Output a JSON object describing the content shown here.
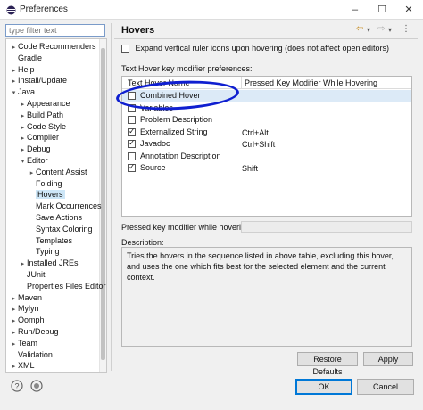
{
  "window": {
    "title": "Preferences",
    "minimize": "–",
    "maximize": "☐",
    "close": "✕"
  },
  "filter": {
    "placeholder": "type filter text"
  },
  "tree": [
    {
      "label": "Code Recommenders",
      "level": 0,
      "arrow": "▸"
    },
    {
      "label": "Gradle",
      "level": 0,
      "arrow": ""
    },
    {
      "label": "Help",
      "level": 0,
      "arrow": "▸"
    },
    {
      "label": "Install/Update",
      "level": 0,
      "arrow": "▸"
    },
    {
      "label": "Java",
      "level": 0,
      "arrow": "▾"
    },
    {
      "label": "Appearance",
      "level": 1,
      "arrow": "▸"
    },
    {
      "label": "Build Path",
      "level": 1,
      "arrow": "▸"
    },
    {
      "label": "Code Style",
      "level": 1,
      "arrow": "▸"
    },
    {
      "label": "Compiler",
      "level": 1,
      "arrow": "▸"
    },
    {
      "label": "Debug",
      "level": 1,
      "arrow": "▸"
    },
    {
      "label": "Editor",
      "level": 1,
      "arrow": "▾"
    },
    {
      "label": "Content Assist",
      "level": 2,
      "arrow": "▸"
    },
    {
      "label": "Folding",
      "level": 2,
      "arrow": ""
    },
    {
      "label": "Hovers",
      "level": 2,
      "arrow": "",
      "selected": true
    },
    {
      "label": "Mark Occurrences",
      "level": 2,
      "arrow": ""
    },
    {
      "label": "Save Actions",
      "level": 2,
      "arrow": ""
    },
    {
      "label": "Syntax Coloring",
      "level": 2,
      "arrow": ""
    },
    {
      "label": "Templates",
      "level": 2,
      "arrow": ""
    },
    {
      "label": "Typing",
      "level": 2,
      "arrow": ""
    },
    {
      "label": "Installed JREs",
      "level": 1,
      "arrow": "▸"
    },
    {
      "label": "JUnit",
      "level": 1,
      "arrow": ""
    },
    {
      "label": "Properties Files Editor",
      "level": 1,
      "arrow": ""
    },
    {
      "label": "Maven",
      "level": 0,
      "arrow": "▸"
    },
    {
      "label": "Mylyn",
      "level": 0,
      "arrow": "▸"
    },
    {
      "label": "Oomph",
      "level": 0,
      "arrow": "▸"
    },
    {
      "label": "Run/Debug",
      "level": 0,
      "arrow": "▸"
    },
    {
      "label": "Team",
      "level": 0,
      "arrow": "▸"
    },
    {
      "label": "Validation",
      "level": 0,
      "arrow": ""
    },
    {
      "label": "XML",
      "level": 0,
      "arrow": "▸"
    }
  ],
  "page": {
    "title": "Hovers",
    "nav_back": "⇦",
    "nav_back_menu": "▾",
    "nav_forward": "⇨",
    "nav_forward_menu": "▾",
    "nav_menu": "⋮",
    "expand_label": "Expand vertical ruler icons upon hovering (does not affect open editors)",
    "prefs_label": "Text Hover key modifier preferences:",
    "col_name": "Text Hover Name",
    "col_key": "Pressed Key Modifier While Hovering",
    "rows": [
      {
        "name": "Combined Hover",
        "key": "",
        "checked": false,
        "selected": true
      },
      {
        "name": "Variables",
        "key": "",
        "checked": false
      },
      {
        "name": "Problem Description",
        "key": "",
        "checked": false
      },
      {
        "name": "Externalized String",
        "key": "Ctrl+Alt",
        "checked": true
      },
      {
        "name": "Javadoc",
        "key": "Ctrl+Shift",
        "checked": true
      },
      {
        "name": "Annotation Description",
        "key": "",
        "checked": false
      },
      {
        "name": "Source",
        "key": "Shift",
        "checked": true
      }
    ],
    "modkey_label": "Pressed key modifier while hovering:",
    "description_label": "Description:",
    "description_text": "Tries the hovers in the sequence listed in above table, excluding this hover, and uses the one which fits best for the selected element and the current context.",
    "restore_defaults": "Restore Defaults",
    "apply": "Apply"
  },
  "footer": {
    "ok": "OK",
    "cancel": "Cancel",
    "help_icon": "help-icon",
    "import_icon": "import-export-icon"
  },
  "colors": {
    "annotation": "#0f1fd0",
    "selection": "#cde6f7",
    "focus": "#0078d7"
  }
}
